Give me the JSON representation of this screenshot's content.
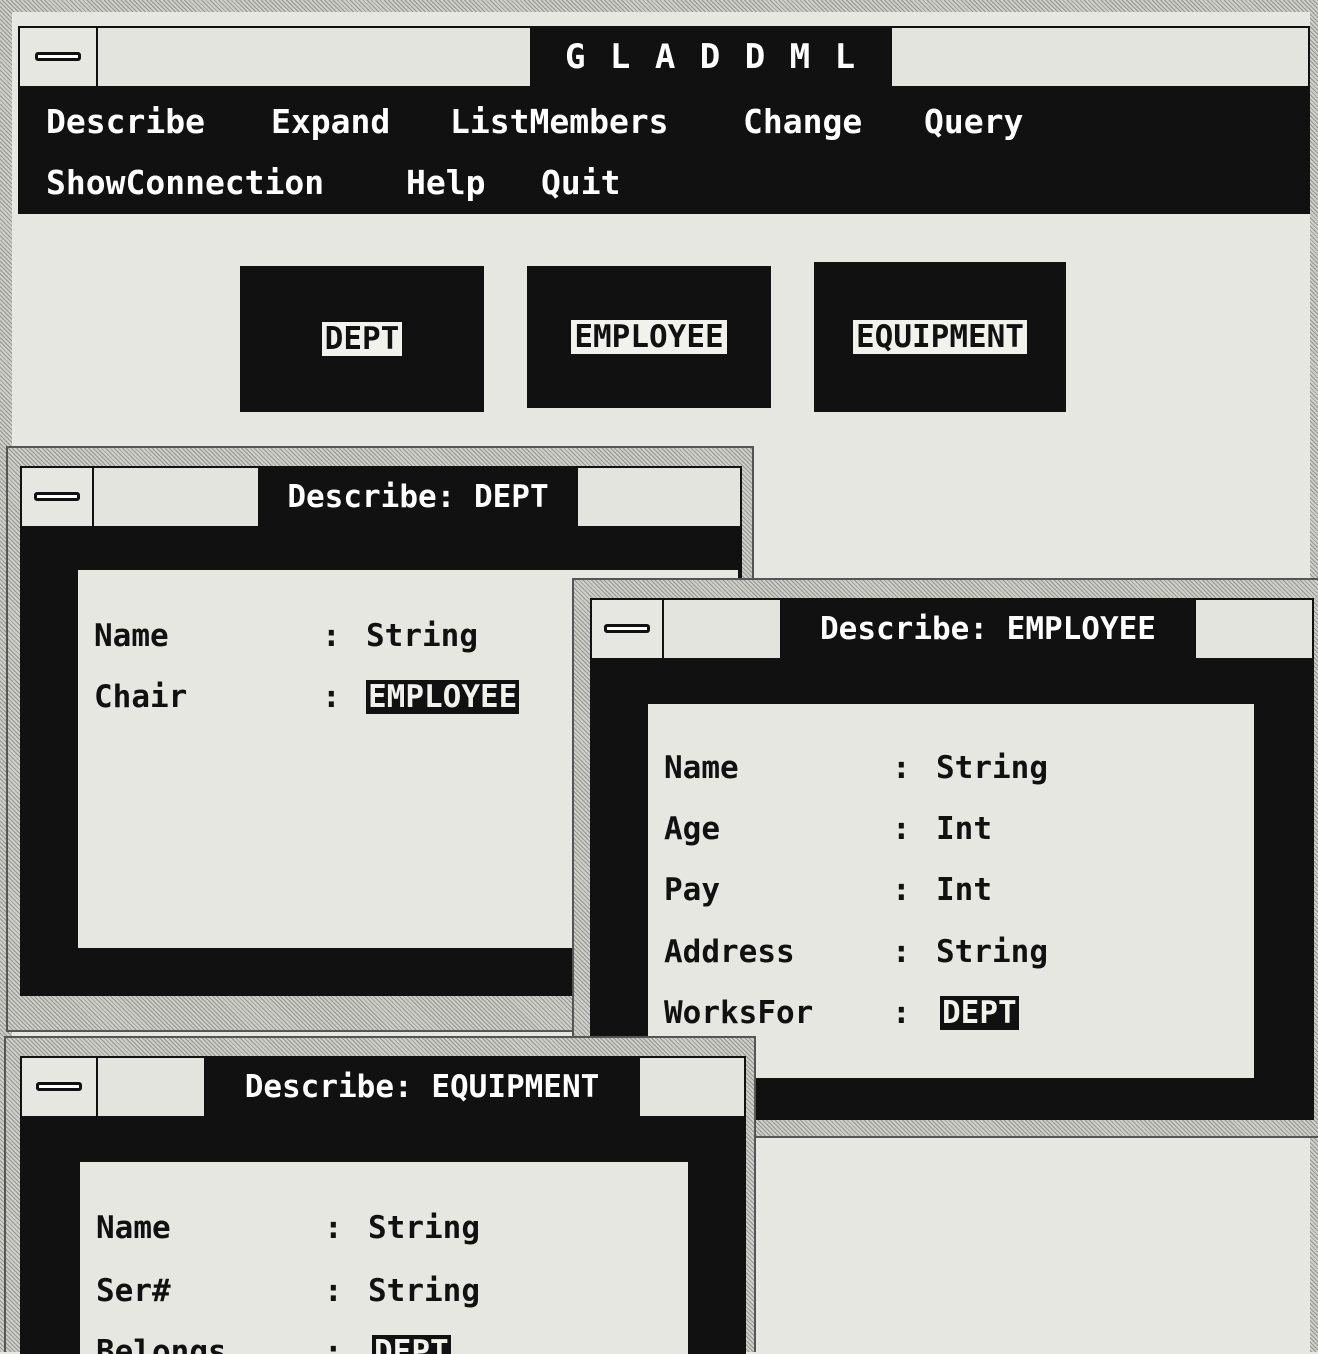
{
  "main_window": {
    "title": "G L A D   D M L",
    "menu": {
      "row1": [
        "Describe",
        "Expand",
        "ListMembers",
        "Change",
        "Query"
      ],
      "row2": [
        "ShowConnection",
        "Help",
        "Quit"
      ]
    },
    "entities": [
      "DEPT",
      "EMPLOYEE",
      "EQUIPMENT"
    ]
  },
  "describe_dept": {
    "title": "Describe: DEPT",
    "attributes": [
      {
        "name": "Name",
        "type": "String",
        "is_link": false
      },
      {
        "name": "Chair",
        "type": "EMPLOYEE",
        "is_link": true
      }
    ]
  },
  "describe_employee": {
    "title": "Describe: EMPLOYEE",
    "attributes": [
      {
        "name": "Name",
        "type": "String",
        "is_link": false
      },
      {
        "name": "Age",
        "type": "Int",
        "is_link": false
      },
      {
        "name": "Pay",
        "type": "Int",
        "is_link": false
      },
      {
        "name": "Address",
        "type": "String",
        "is_link": false
      },
      {
        "name": "WorksFor",
        "type": "DEPT",
        "is_link": true
      }
    ]
  },
  "describe_equipment": {
    "title": "Describe: EQUIPMENT",
    "attributes": [
      {
        "name": "Name",
        "type": "String",
        "is_link": false
      },
      {
        "name": "Ser#",
        "type": "String",
        "is_link": false
      },
      {
        "name": "Belongs",
        "type": "DEPT",
        "is_link": true
      }
    ]
  },
  "colors": {
    "window_bg": "#e7e7e1",
    "frame": "#111111",
    "highlight_text": "#f2f2ec"
  }
}
